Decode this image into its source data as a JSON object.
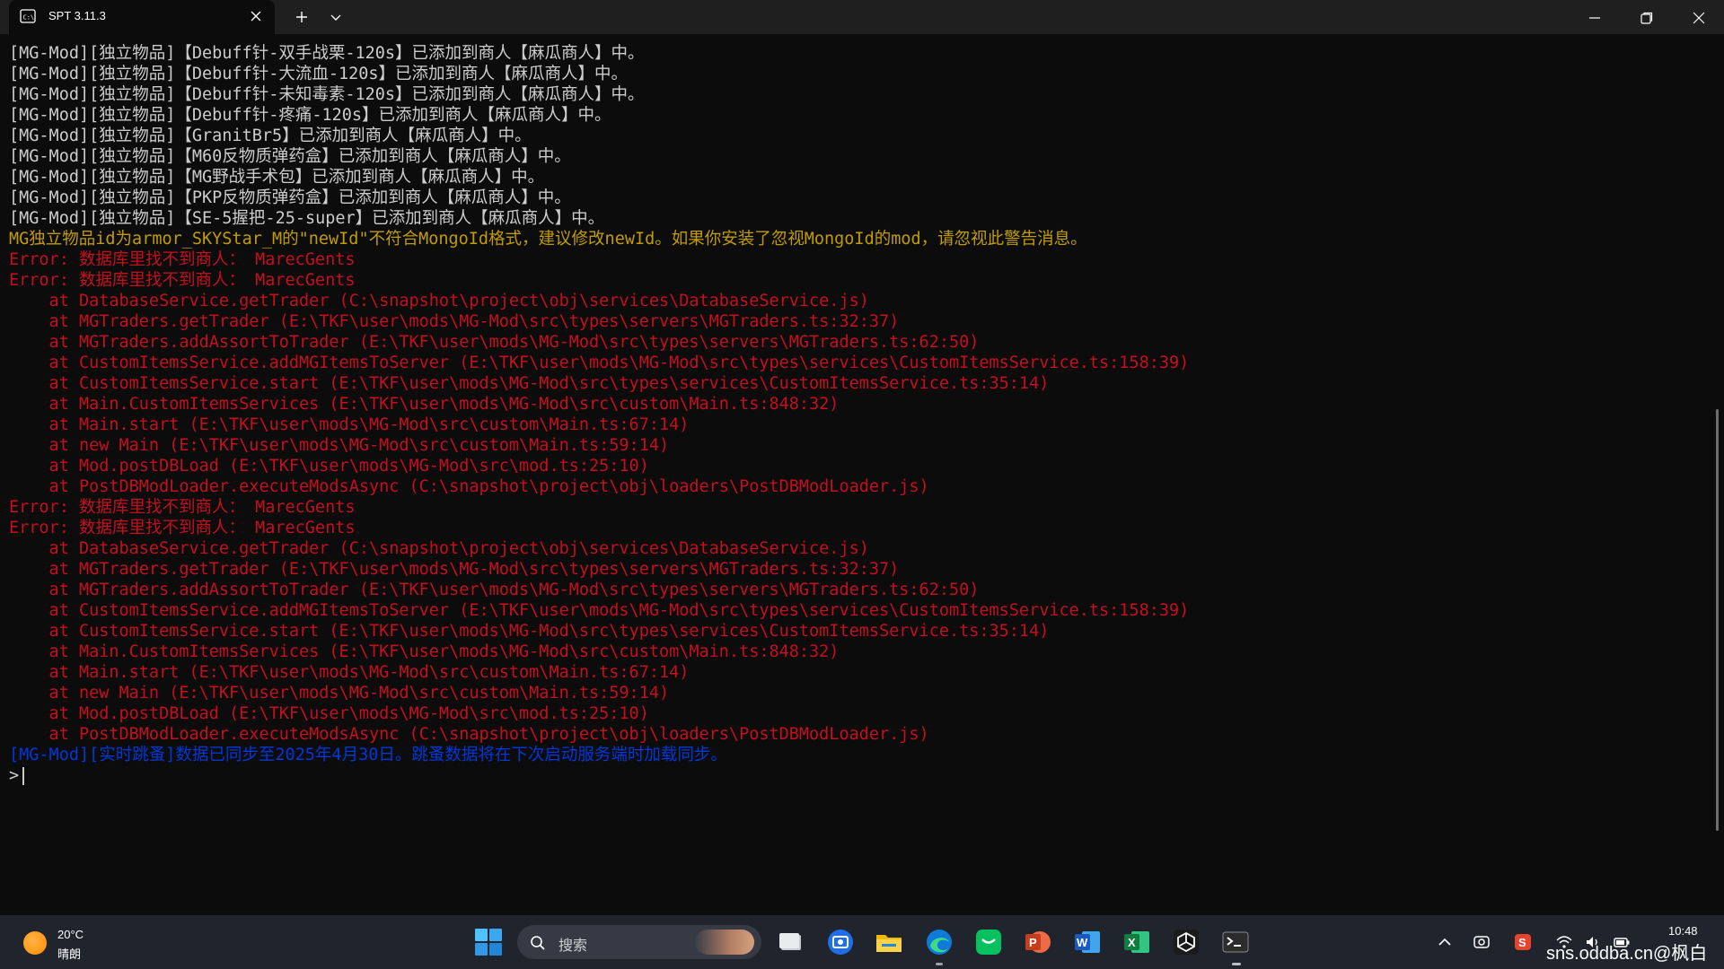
{
  "window": {
    "tab_title": "SPT 3.11.3"
  },
  "terminal": {
    "lines": [
      {
        "text": "[MG-Mod][独立物品]【Debuff针-双手战栗-120s】已添加到商人【麻瓜商人】中。",
        "color": "white"
      },
      {
        "text": "[MG-Mod][独立物品]【Debuff针-大流血-120s】已添加到商人【麻瓜商人】中。",
        "color": "white"
      },
      {
        "text": "[MG-Mod][独立物品]【Debuff针-未知毒素-120s】已添加到商人【麻瓜商人】中。",
        "color": "white"
      },
      {
        "text": "[MG-Mod][独立物品]【Debuff针-疼痛-120s】已添加到商人【麻瓜商人】中。",
        "color": "white"
      },
      {
        "text": "[MG-Mod][独立物品]【GranitBr5】已添加到商人【麻瓜商人】中。",
        "color": "white"
      },
      {
        "text": "[MG-Mod][独立物品]【M60反物质弹药盒】已添加到商人【麻瓜商人】中。",
        "color": "white"
      },
      {
        "text": "[MG-Mod][独立物品]【MG野战手术包】已添加到商人【麻瓜商人】中。",
        "color": "white"
      },
      {
        "text": "[MG-Mod][独立物品]【PKP反物质弹药盒】已添加到商人【麻瓜商人】中。",
        "color": "white"
      },
      {
        "text": "[MG-Mod][独立物品]【SE-5握把-25-super】已添加到商人【麻瓜商人】中。",
        "color": "white"
      },
      {
        "text": "MG独立物品id为armor_SKYStar_M的\"newId\"不符合MongoId格式，建议修改newId。如果你安装了忽视MongoId的mod，请忽视此警告消息。",
        "color": "yellow"
      },
      {
        "text": "Error: 数据库里找不到商人： MarecGents",
        "color": "red"
      },
      {
        "text": "Error: 数据库里找不到商人： MarecGents",
        "color": "red"
      },
      {
        "text": "    at DatabaseService.getTrader (C:\\snapshot\\project\\obj\\services\\DatabaseService.js)",
        "color": "red"
      },
      {
        "text": "    at MGTraders.getTrader (E:\\TKF\\user\\mods\\MG-Mod\\src\\types\\servers\\MGTraders.ts:32:37)",
        "color": "red"
      },
      {
        "text": "    at MGTraders.addAssortToTrader (E:\\TKF\\user\\mods\\MG-Mod\\src\\types\\servers\\MGTraders.ts:62:50)",
        "color": "red"
      },
      {
        "text": "    at CustomItemsService.addMGItemsToServer (E:\\TKF\\user\\mods\\MG-Mod\\src\\types\\services\\CustomItemsService.ts:158:39)",
        "color": "red"
      },
      {
        "text": "    at CustomItemsService.start (E:\\TKF\\user\\mods\\MG-Mod\\src\\types\\services\\CustomItemsService.ts:35:14)",
        "color": "red"
      },
      {
        "text": "    at Main.CustomItemsServices (E:\\TKF\\user\\mods\\MG-Mod\\src\\custom\\Main.ts:848:32)",
        "color": "red"
      },
      {
        "text": "    at Main.start (E:\\TKF\\user\\mods\\MG-Mod\\src\\custom\\Main.ts:67:14)",
        "color": "red"
      },
      {
        "text": "    at new Main (E:\\TKF\\user\\mods\\MG-Mod\\src\\custom\\Main.ts:59:14)",
        "color": "red"
      },
      {
        "text": "    at Mod.postDBLoad (E:\\TKF\\user\\mods\\MG-Mod\\src\\mod.ts:25:10)",
        "color": "red"
      },
      {
        "text": "    at PostDBModLoader.executeModsAsync (C:\\snapshot\\project\\obj\\loaders\\PostDBModLoader.js)",
        "color": "red"
      },
      {
        "text": "Error: 数据库里找不到商人： MarecGents",
        "color": "red"
      },
      {
        "text": "Error: 数据库里找不到商人： MarecGents",
        "color": "red"
      },
      {
        "text": "    at DatabaseService.getTrader (C:\\snapshot\\project\\obj\\services\\DatabaseService.js)",
        "color": "red"
      },
      {
        "text": "    at MGTraders.getTrader (E:\\TKF\\user\\mods\\MG-Mod\\src\\types\\servers\\MGTraders.ts:32:37)",
        "color": "red"
      },
      {
        "text": "    at MGTraders.addAssortToTrader (E:\\TKF\\user\\mods\\MG-Mod\\src\\types\\servers\\MGTraders.ts:62:50)",
        "color": "red"
      },
      {
        "text": "    at CustomItemsService.addMGItemsToServer (E:\\TKF\\user\\mods\\MG-Mod\\src\\types\\services\\CustomItemsService.ts:158:39)",
        "color": "red"
      },
      {
        "text": "    at CustomItemsService.start (E:\\TKF\\user\\mods\\MG-Mod\\src\\types\\services\\CustomItemsService.ts:35:14)",
        "color": "red"
      },
      {
        "text": "    at Main.CustomItemsServices (E:\\TKF\\user\\mods\\MG-Mod\\src\\custom\\Main.ts:848:32)",
        "color": "red"
      },
      {
        "text": "    at Main.start (E:\\TKF\\user\\mods\\MG-Mod\\src\\custom\\Main.ts:67:14)",
        "color": "red"
      },
      {
        "text": "    at new Main (E:\\TKF\\user\\mods\\MG-Mod\\src\\custom\\Main.ts:59:14)",
        "color": "red"
      },
      {
        "text": "    at Mod.postDBLoad (E:\\TKF\\user\\mods\\MG-Mod\\src\\mod.ts:25:10)",
        "color": "red"
      },
      {
        "text": "    at PostDBModLoader.executeModsAsync (C:\\snapshot\\project\\obj\\loaders\\PostDBModLoader.js)",
        "color": "red"
      },
      {
        "text": "[MG-Mod][实时跳蚤]数据已同步至2025年4月30日。跳蚤数据将在下次启动服务端时加载同步。",
        "color": "blue"
      }
    ],
    "prompt": ">",
    "colors": {
      "white": "#cccccc",
      "yellow": "#c19c00",
      "red": "#c50f1f",
      "blue": "#0037da"
    }
  },
  "taskbar": {
    "weather_temp": "20°C",
    "weather_condition": "晴朗",
    "search_placeholder": "搜索",
    "time": "10:48",
    "watermark": "sns.oddba.cn@枫白",
    "apps": [
      "task-view",
      "screen-capture",
      "file-explorer",
      "edge",
      "wechat",
      "powerpoint",
      "word",
      "excel",
      "unity",
      "terminal"
    ]
  }
}
